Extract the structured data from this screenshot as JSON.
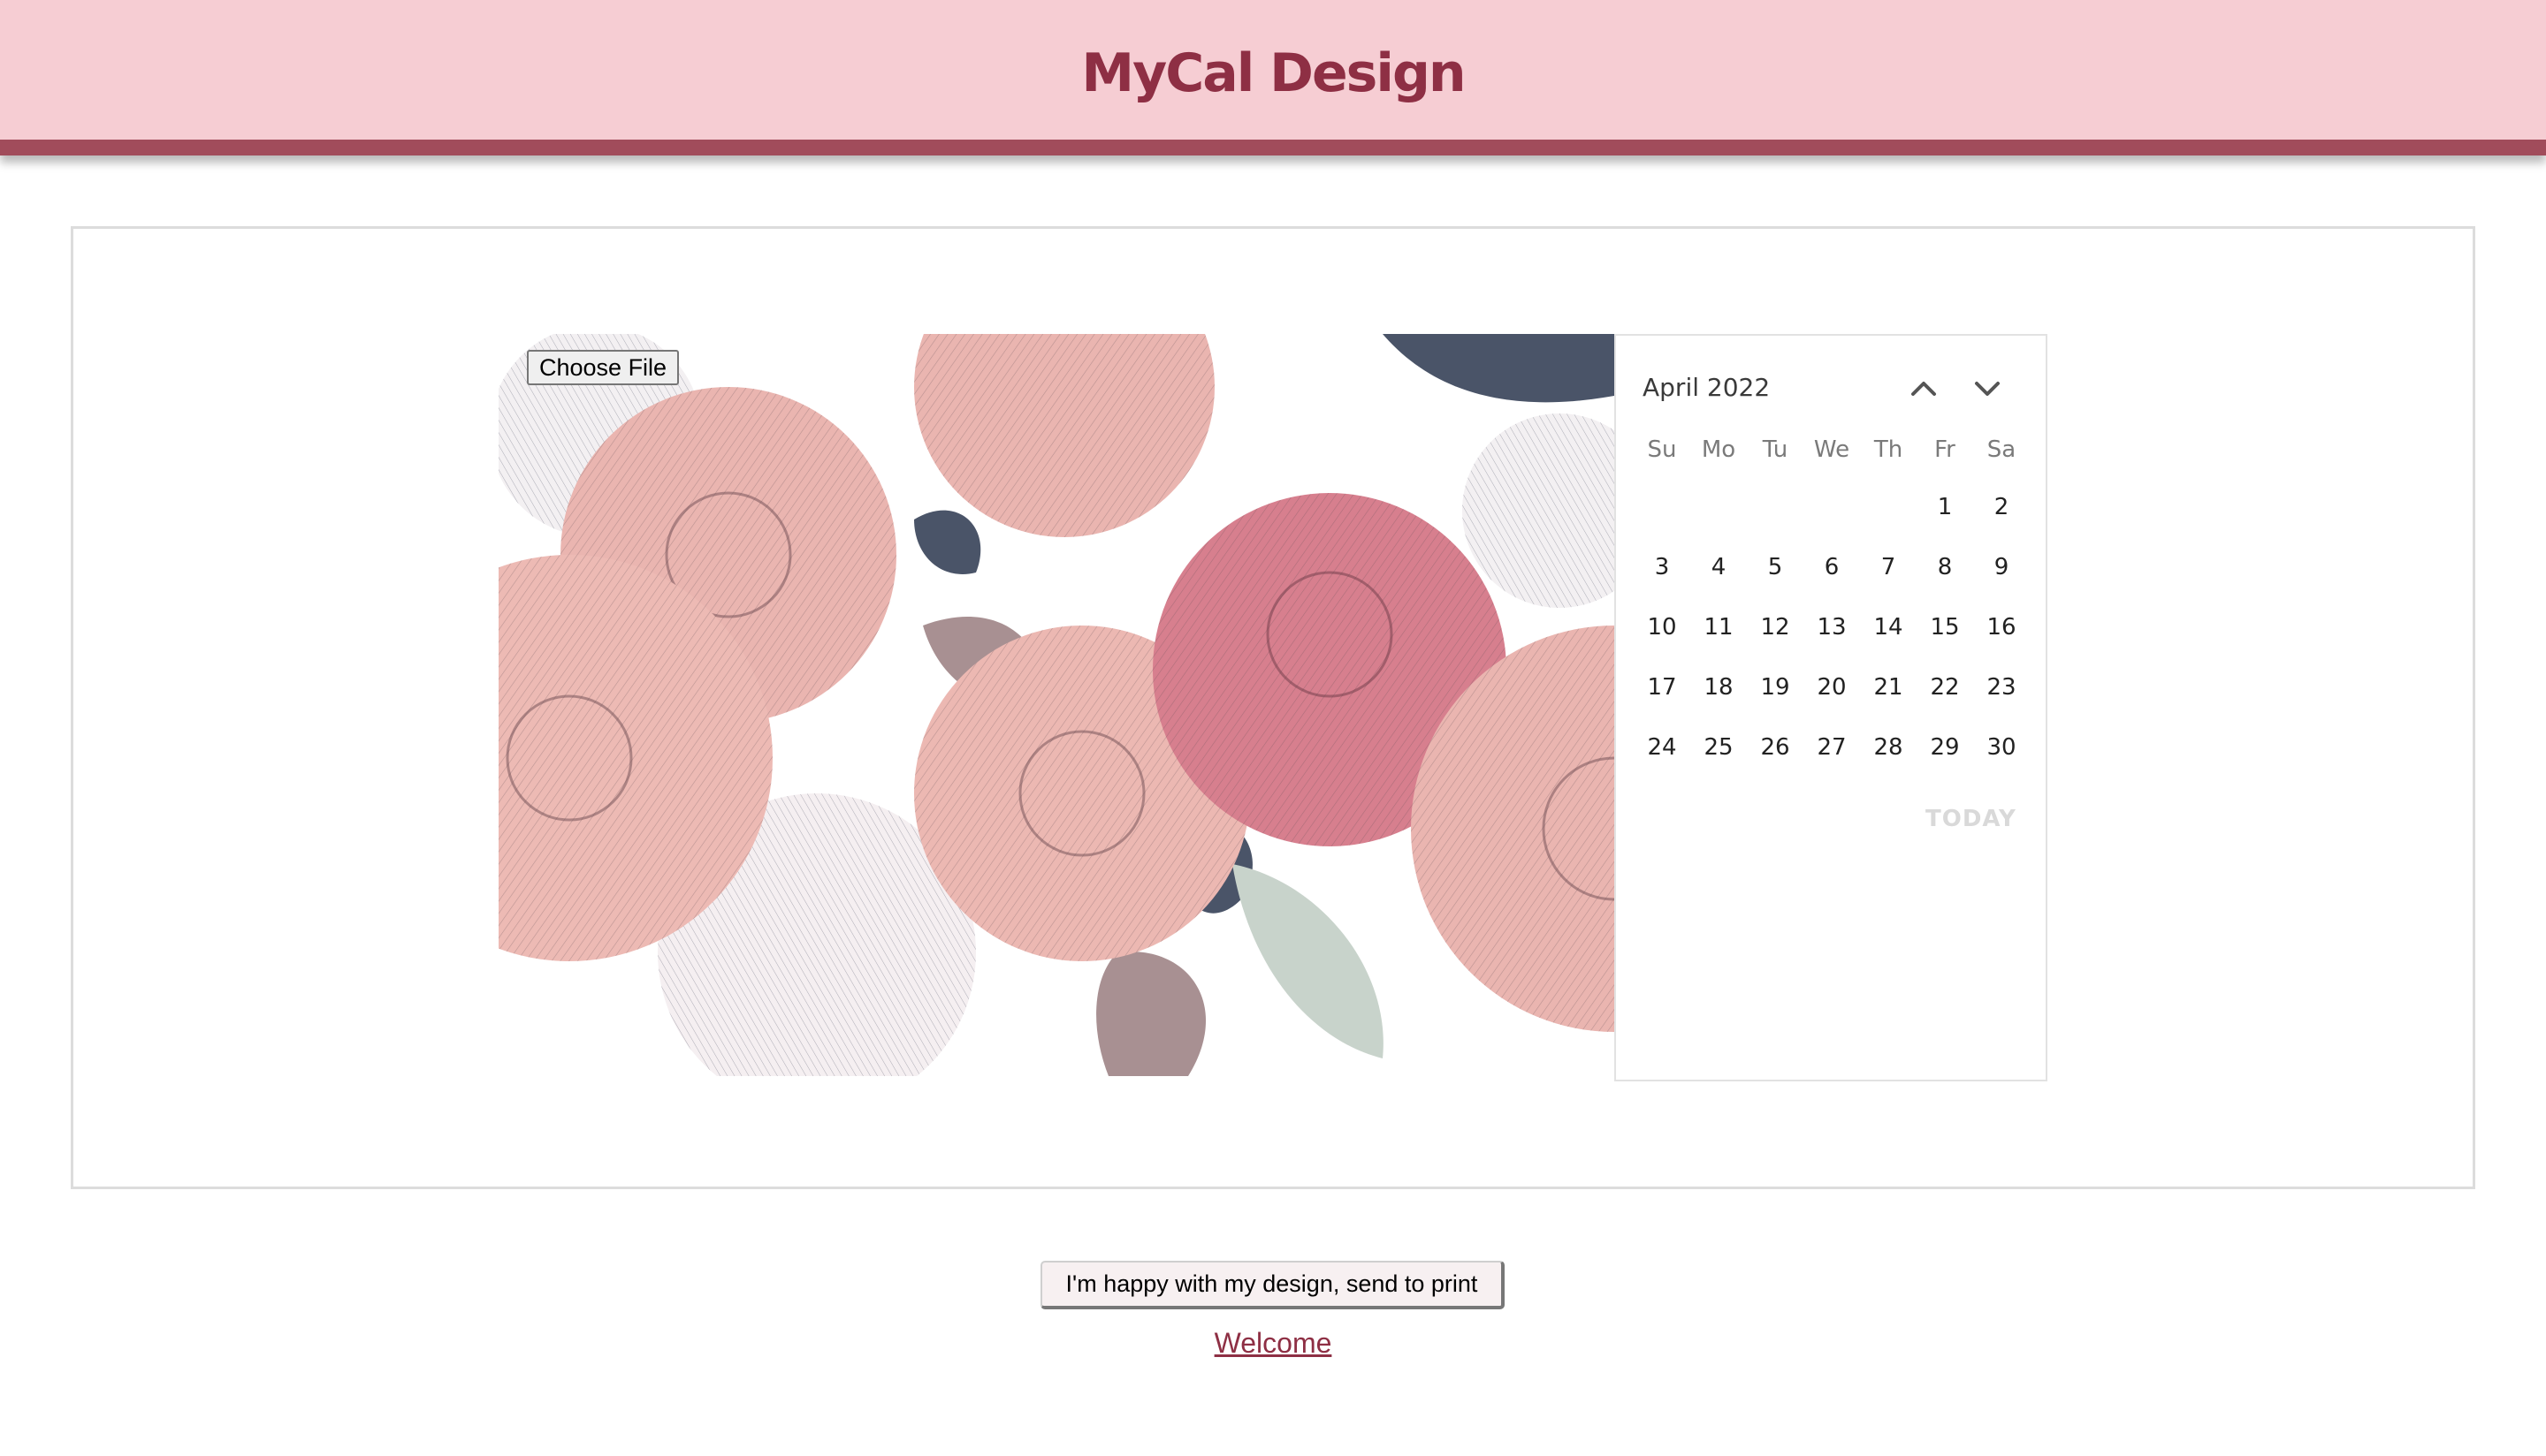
{
  "header": {
    "title": "MyCal Design"
  },
  "upload": {
    "choose_file_label": "Choose File"
  },
  "calendar": {
    "month_label": "April 2022",
    "prev_icon": "chevron-up-icon",
    "next_icon": "chevron-down-icon",
    "weekdays": [
      "Su",
      "Mo",
      "Tu",
      "We",
      "Th",
      "Fr",
      "Sa"
    ],
    "weeks": [
      [
        "",
        "",
        "",
        "",
        "",
        "1",
        "2"
      ],
      [
        "3",
        "4",
        "5",
        "6",
        "7",
        "8",
        "9"
      ],
      [
        "10",
        "11",
        "12",
        "13",
        "14",
        "15",
        "16"
      ],
      [
        "17",
        "18",
        "19",
        "20",
        "21",
        "22",
        "23"
      ],
      [
        "24",
        "25",
        "26",
        "27",
        "28",
        "29",
        "30"
      ]
    ],
    "today_label": "TODAY"
  },
  "actions": {
    "print_label": "I'm happy with my design, send to print",
    "welcome_link": "Welcome"
  },
  "colors": {
    "header_bg": "#f6cdd3",
    "header_border": "#a14c5b",
    "brand": "#8e2f44",
    "rose_pink": "#eab5b0",
    "rose_deep": "#d77f8e",
    "leaf_dark": "#4a5468"
  }
}
